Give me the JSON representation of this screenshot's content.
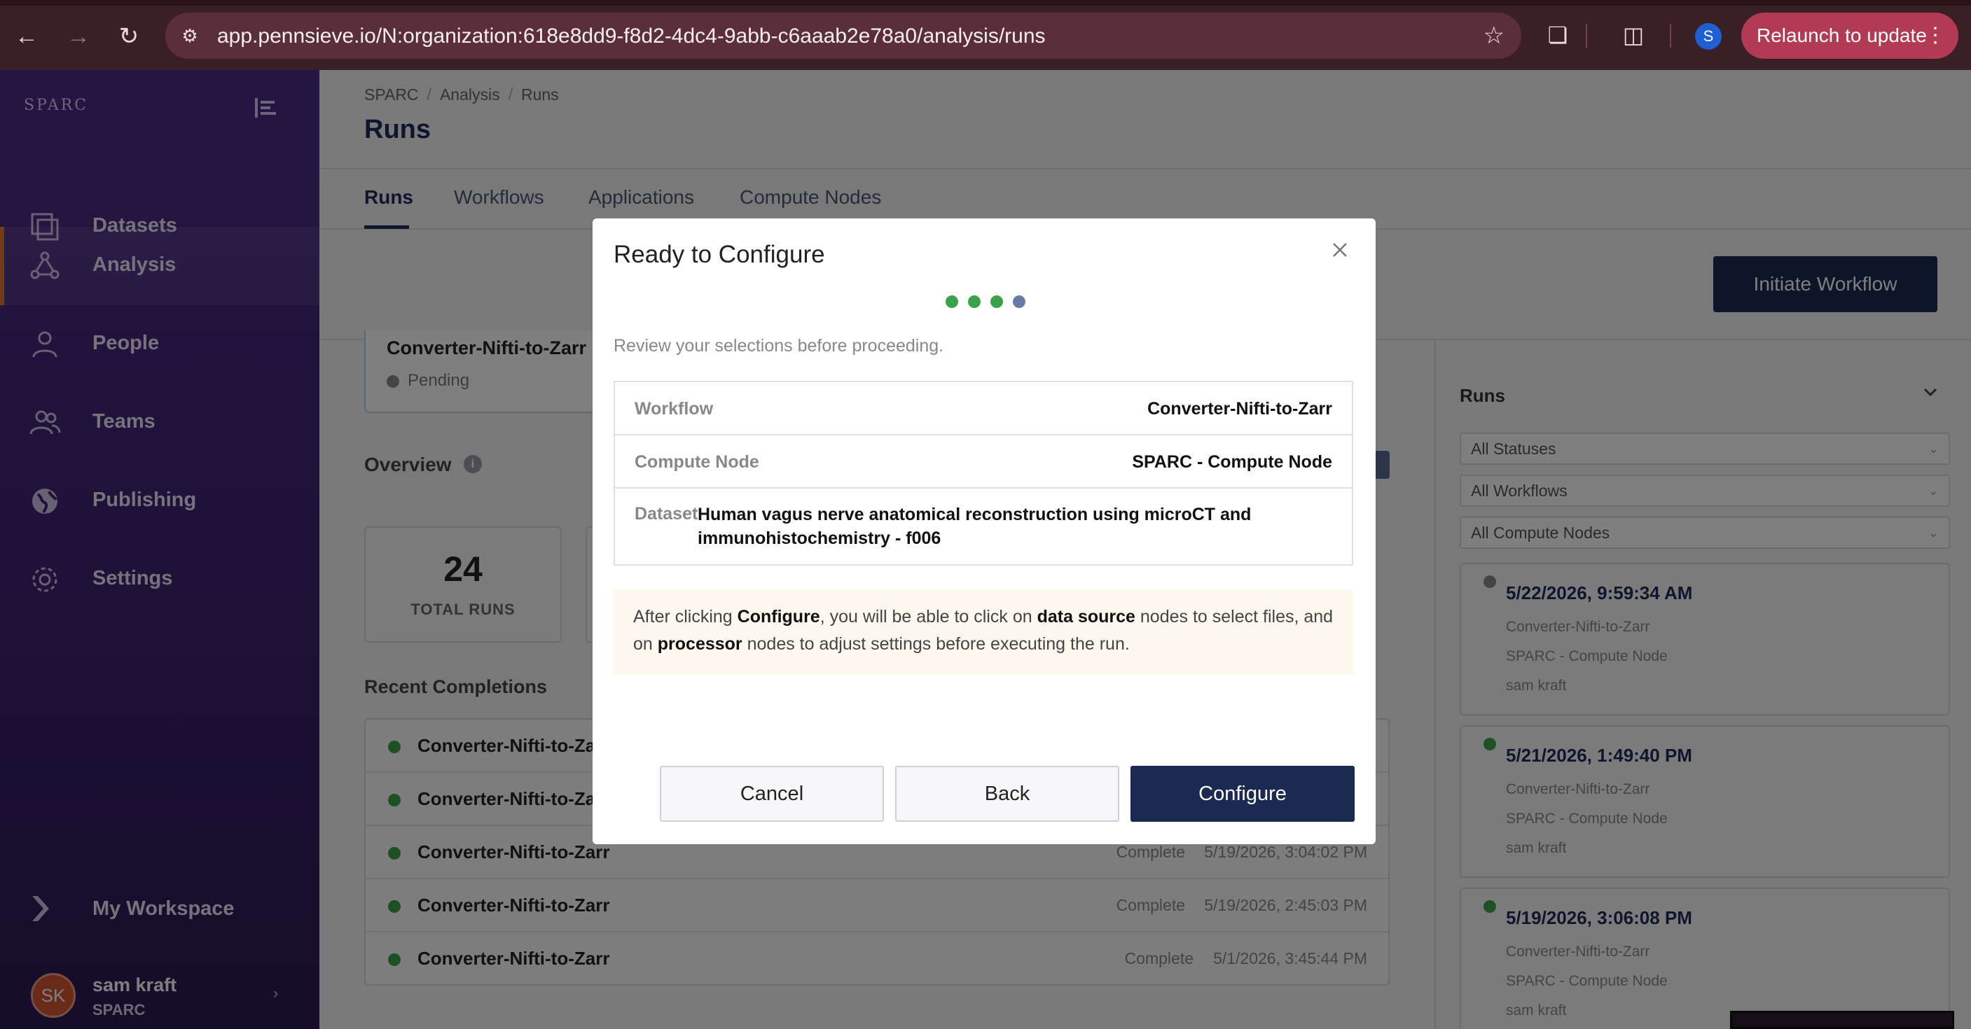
{
  "browser": {
    "url": "app.pennsieve.io/N:organization:618e8dd9-f8d2-4dc4-9abb-c6aaab2e78a0/analysis/runs",
    "profile_initial": "S",
    "relaunch_label": "Relaunch to update"
  },
  "sidebar": {
    "logo": "SPARC",
    "items": [
      {
        "label": "Datasets",
        "icon": "datasets-icon"
      },
      {
        "label": "Analysis",
        "icon": "analysis-icon",
        "active": true
      },
      {
        "label": "People",
        "icon": "person-icon"
      },
      {
        "label": "Teams",
        "icon": "teams-icon"
      },
      {
        "label": "Publishing",
        "icon": "globe-icon"
      },
      {
        "label": "Settings",
        "icon": "gear-icon"
      }
    ],
    "workspace_label": "My Workspace",
    "user": {
      "initials": "SK",
      "name": "sam kraft",
      "org": "SPARC"
    }
  },
  "header": {
    "breadcrumb": [
      "SPARC",
      "Analysis",
      "Runs"
    ],
    "title": "Runs"
  },
  "tabs": [
    "Runs",
    "Workflows",
    "Applications",
    "Compute Nodes"
  ],
  "initiate_label": "Initiate Workflow",
  "active_run": {
    "name": "Converter-Nifti-to-Zarr",
    "status": "Pending"
  },
  "overview": {
    "title": "Overview",
    "total_runs": "24",
    "total_runs_label": "TOTAL RUNS"
  },
  "recent": {
    "title": "Recent Completions",
    "rows": [
      {
        "name": "Converter-Nifti-to-Zarr",
        "status": "",
        "date": ""
      },
      {
        "name": "Converter-Nifti-to-Zarr",
        "status": "",
        "date": ""
      },
      {
        "name": "Converter-Nifti-to-Zarr",
        "status": "Complete",
        "date": "5/19/2026, 3:04:02 PM"
      },
      {
        "name": "Converter-Nifti-to-Zarr",
        "status": "Complete",
        "date": "5/19/2026, 2:45:03 PM"
      },
      {
        "name": "Converter-Nifti-to-Zarr",
        "status": "Complete",
        "date": "5/1/2026, 3:45:44 PM"
      }
    ]
  },
  "runs_panel": {
    "title": "Runs",
    "filters": [
      "All Statuses",
      "All Workflows",
      "All Compute Nodes"
    ],
    "cards": [
      {
        "when": "5/22/2026, 9:59:34 AM",
        "workflow": "Converter-Nifti-to-Zarr",
        "node": "SPARC - Compute Node",
        "user": "sam kraft",
        "status_color": "#8a8a8a"
      },
      {
        "when": "5/21/2026, 1:49:40 PM",
        "workflow": "Converter-Nifti-to-Zarr",
        "node": "SPARC - Compute Node",
        "user": "sam kraft",
        "status_color": "#3aa24a"
      },
      {
        "when": "5/19/2026, 3:06:08 PM",
        "workflow": "Converter-Nifti-to-Zarr",
        "node": "SPARC - Compute Node",
        "user": "sam kraft",
        "status_color": "#3aa24a"
      }
    ]
  },
  "modal": {
    "title": "Ready to Configure",
    "subtitle": "Review your selections before proceeding.",
    "steps_complete": 3,
    "steps_total": 4,
    "summary": {
      "workflow_key": "Workflow",
      "workflow_value": "Converter-Nifti-to-Zarr",
      "node_key": "Compute Node",
      "node_value": "SPARC - Compute Node",
      "dataset_key": "Dataset",
      "dataset_value": "Human vagus nerve anatomical reconstruction using microCT and immunohistochemistry - f006"
    },
    "note": {
      "p1": "After clicking ",
      "b1": "Configure",
      "p2": ", you will be able to click on ",
      "b2": "data source",
      "p3": " nodes to select files, and on ",
      "b3": "processor",
      "p4": " nodes to adjust settings before executing the run."
    },
    "cancel_label": "Cancel",
    "back_label": "Back",
    "configure_label": "Configure"
  },
  "colors": {
    "primary": "#1a2a50",
    "step_done": "#3aa24a",
    "step_current": "#6a7aa6",
    "accent": "#e07b2a"
  }
}
